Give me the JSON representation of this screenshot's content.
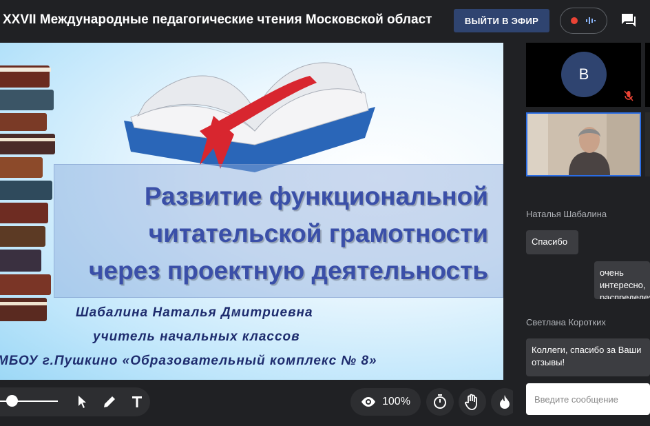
{
  "header": {
    "title": "XXVII Международные педагогические чтения Московской област",
    "live_button": "ВЫЙТИ В ЭФИР"
  },
  "slide": {
    "title_lines": [
      "Развитие функциональной",
      "читательской грамотности",
      "через проектную деятельность"
    ],
    "author": "Шабалина  Наталья  Дмитриевна",
    "position": "учитель  начальных  классов",
    "school": "МБОУ г.Пушкино «Образовательный  комплекс  № 8»"
  },
  "toolbar": {
    "zoom": "100%"
  },
  "participants": {
    "tile1_initial": "В"
  },
  "chat": {
    "messages": [
      {
        "sender": "Наталья Шабалина",
        "text": "Спасибо"
      },
      {
        "sender": "",
        "text": "очень интересно, распределение"
      },
      {
        "sender": "Светлана Коротких",
        "text": "Коллеги, спасибо за Ваши отзывы!"
      }
    ],
    "input_placeholder": "Введите сообщение"
  },
  "colors": {
    "background": "#202124",
    "accent": "#2f4470",
    "record": "#ea4335",
    "active_border": "#2b6de4"
  }
}
